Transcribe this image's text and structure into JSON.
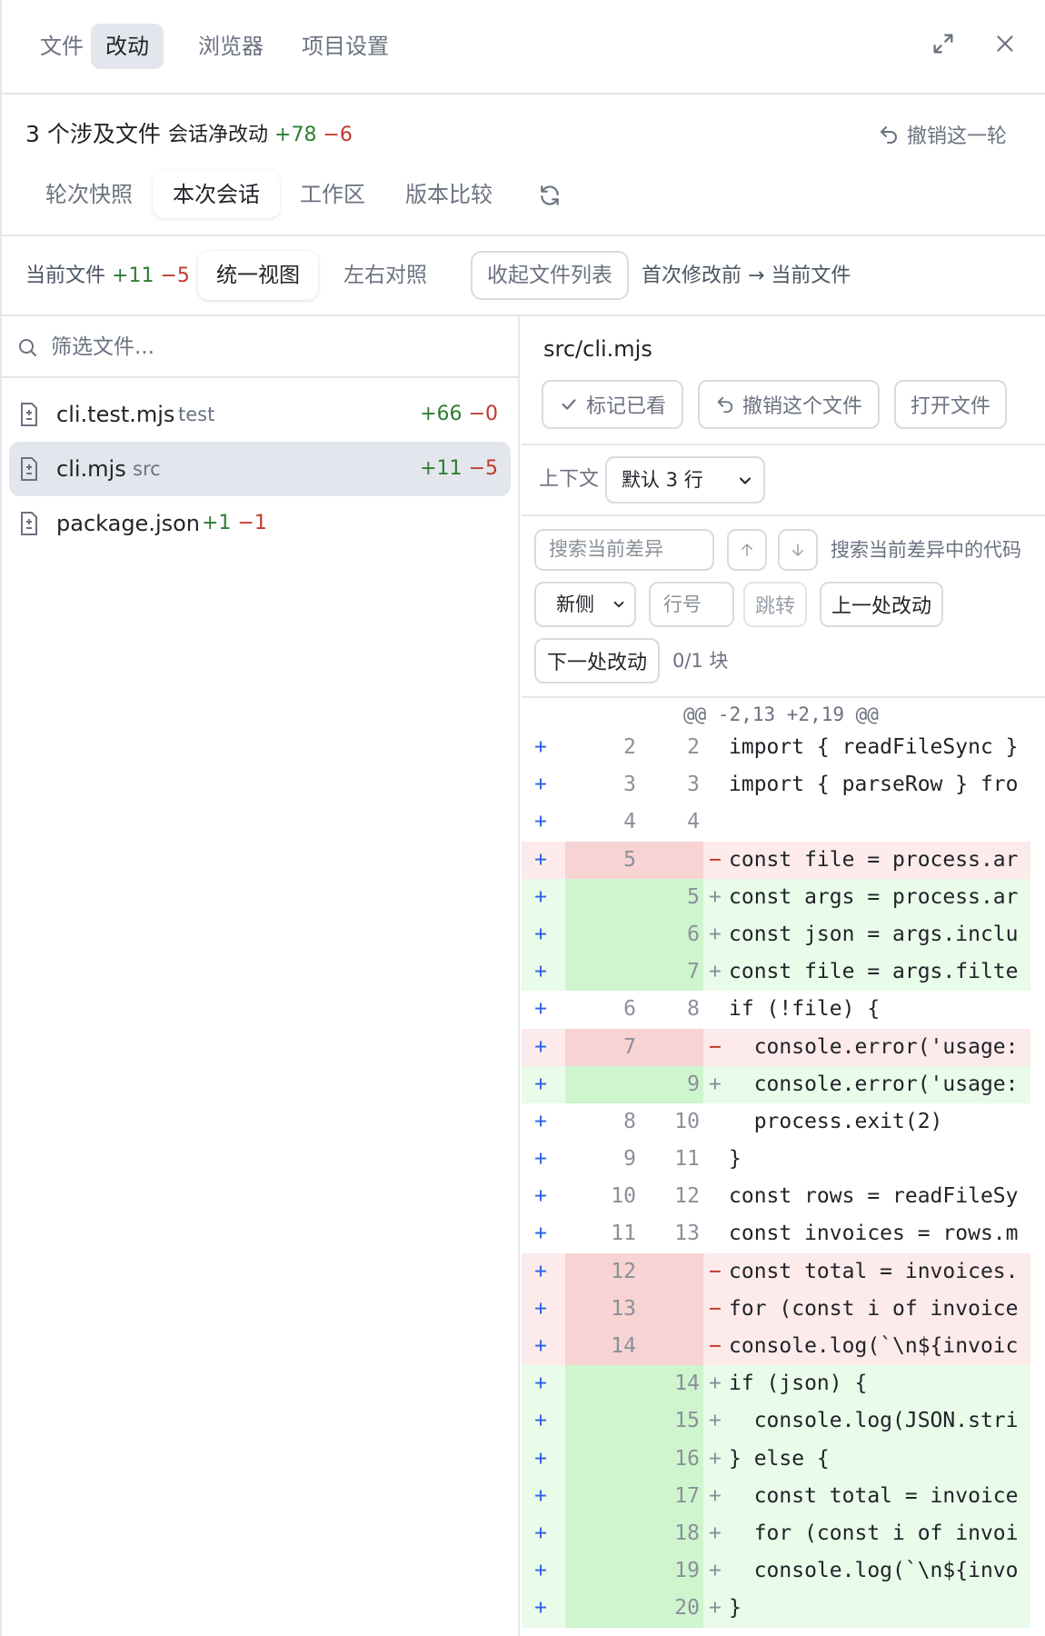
{
  "top_tabs": [
    "文件",
    "改动",
    "浏览器",
    "项目设置"
  ],
  "summary": {
    "files_count": "3 个涉及文件",
    "net_label": "会话净改动",
    "net_add": "+78",
    "net_del": "−6",
    "revert_round": "撤销这一轮"
  },
  "sub_tabs": [
    "轮次快照",
    "本次会话",
    "工作区",
    "版本比较"
  ],
  "view_row": {
    "current_file_label": "当前文件",
    "current_add": "+11",
    "current_del": "−5",
    "unified": "统一视图",
    "split": "左右对照",
    "collapse": "收起文件列表",
    "compare_label": "首次修改前 → 当前文件"
  },
  "filter": {
    "placeholder": "筛选文件..."
  },
  "files": [
    {
      "name": "cli.test.mjs",
      "dir": "test",
      "add": "+66",
      "del": "−0"
    },
    {
      "name": "cli.mjs",
      "dir": "src",
      "add": "+11",
      "del": "−5"
    },
    {
      "name": "package.json",
      "dir": "",
      "add": "+1",
      "del": "−1"
    }
  ],
  "detail": {
    "path": "src/cli.mjs",
    "mark_seen": "标记已看",
    "revert_file": "撤销这个文件",
    "open_file": "打开文件",
    "context_label": "上下文",
    "context_value": "默认 3 行",
    "search_placeholder": "搜索当前差异",
    "search_code_label": "搜索当前差异中的代码",
    "side_value": "新侧",
    "line_placeholder": "行号",
    "jump": "跳转",
    "prev_change": "上一处改动",
    "next_change": "下一处改动",
    "block_count": "0/1 块"
  },
  "diff": {
    "hunk": "@@ -2,13 +2,19 @@",
    "lines": [
      {
        "t": "ctx",
        "o": "2",
        "n": "2",
        "c": "import { readFileSync }"
      },
      {
        "t": "ctx",
        "o": "3",
        "n": "3",
        "c": "import { parseRow } fro"
      },
      {
        "t": "ctx",
        "o": "4",
        "n": "4",
        "c": ""
      },
      {
        "t": "del",
        "o": "5",
        "n": "",
        "c": "const file = process.ar"
      },
      {
        "t": "add",
        "o": "",
        "n": "5",
        "c": "const args = process.ar"
      },
      {
        "t": "add",
        "o": "",
        "n": "6",
        "c": "const json = args.inclu"
      },
      {
        "t": "add",
        "o": "",
        "n": "7",
        "c": "const file = args.filte"
      },
      {
        "t": "ctx",
        "o": "6",
        "n": "8",
        "c": "if (!file) {"
      },
      {
        "t": "del",
        "o": "7",
        "n": "",
        "c": "  console.error('usage:"
      },
      {
        "t": "add",
        "o": "",
        "n": "9",
        "c": "  console.error('usage:"
      },
      {
        "t": "ctx",
        "o": "8",
        "n": "10",
        "c": "  process.exit(2)"
      },
      {
        "t": "ctx",
        "o": "9",
        "n": "11",
        "c": "}"
      },
      {
        "t": "ctx",
        "o": "10",
        "n": "12",
        "c": "const rows = readFileSy"
      },
      {
        "t": "ctx",
        "o": "11",
        "n": "13",
        "c": "const invoices = rows.m"
      },
      {
        "t": "del",
        "o": "12",
        "n": "",
        "c": "const total = invoices."
      },
      {
        "t": "del",
        "o": "13",
        "n": "",
        "c": "for (const i of invoice"
      },
      {
        "t": "del",
        "o": "14",
        "n": "",
        "c": "console.log(`\\n${invoic"
      },
      {
        "t": "add",
        "o": "",
        "n": "14",
        "c": "if (json) {"
      },
      {
        "t": "add",
        "o": "",
        "n": "15",
        "c": "  console.log(JSON.stri"
      },
      {
        "t": "add",
        "o": "",
        "n": "16",
        "c": "} else {"
      },
      {
        "t": "add",
        "o": "",
        "n": "17",
        "c": "  const total = invoice"
      },
      {
        "t": "add",
        "o": "",
        "n": "18",
        "c": "  for (const i of invoi"
      },
      {
        "t": "add",
        "o": "",
        "n": "19",
        "c": "  console.log(`\\n${invo"
      },
      {
        "t": "add",
        "o": "",
        "n": "20",
        "c": "}"
      }
    ]
  },
  "colors": {
    "add": "#2f7d32",
    "del": "#c0392b",
    "accent": "#2563eb"
  },
  "icons": [
    "expand-icon",
    "close-icon",
    "undo-icon",
    "refresh-icon",
    "search-icon",
    "file-diff-icon",
    "check-icon",
    "chevron-down-icon",
    "arrow-up-icon",
    "arrow-down-icon"
  ]
}
